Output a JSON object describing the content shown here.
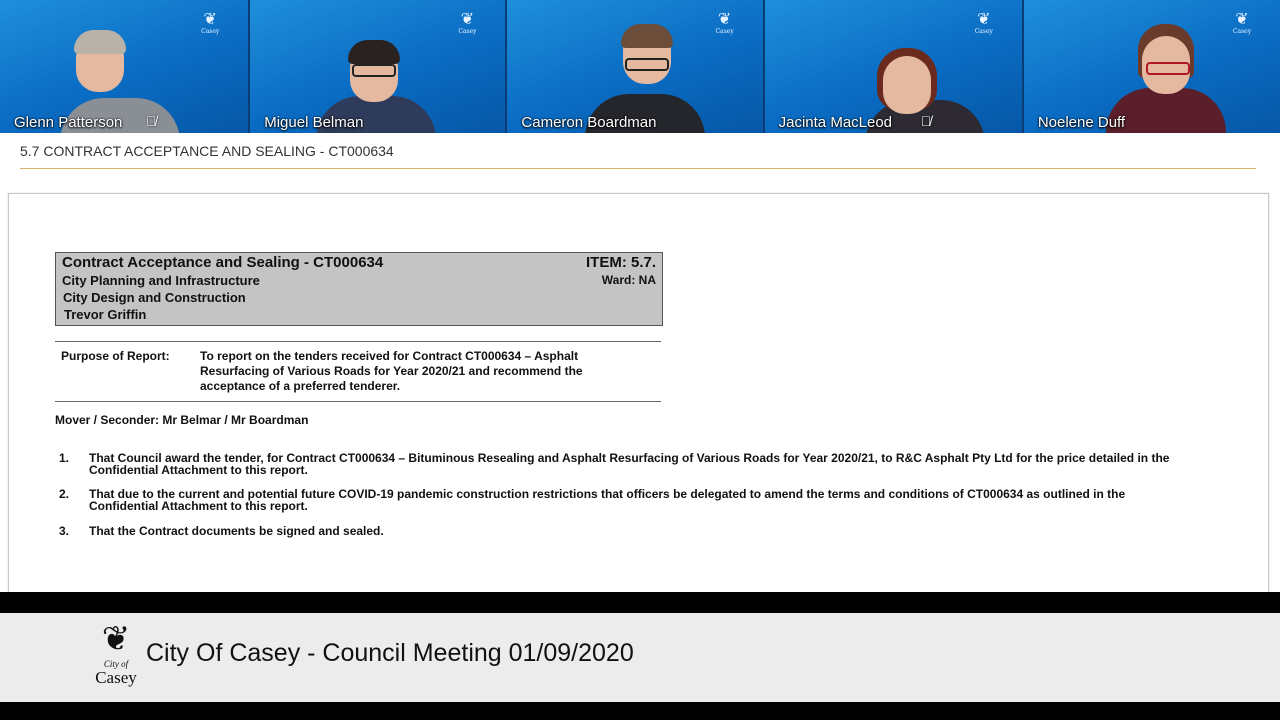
{
  "participants": [
    {
      "name": "Glenn Patterson",
      "muted": true,
      "mic_icon": "mic-off-icon"
    },
    {
      "name": "Miguel Belman",
      "muted": false,
      "mic_icon": ""
    },
    {
      "name": "Cameron Boardman",
      "muted": false,
      "mic_icon": ""
    },
    {
      "name": "Jacinta MacLeod",
      "muted": true,
      "mic_icon": "mic-off-icon"
    },
    {
      "name": "Noelene Duff",
      "muted": false,
      "mic_icon": ""
    }
  ],
  "tile_logo": {
    "mark": "❦",
    "text_top": "City of",
    "text_bottom": "Casey"
  },
  "agenda_item": "5.7 CONTRACT ACCEPTANCE AND SEALING - CT000634",
  "report": {
    "heading": "Contract Acceptance and Sealing - CT000634",
    "item": "ITEM: 5.7.",
    "ward": "Ward: NA",
    "department": "City Planning and Infrastructure",
    "branch": "City Design and Construction",
    "officer": "Trevor Griffin",
    "purpose_label": "Purpose of Report:",
    "purpose_text": "To report on the tenders received for Contract CT000634 – Asphalt Resurfacing of Various Roads for Year 2020/21 and recommend the acceptance of a preferred tenderer.",
    "mover": "Mover / Seconder: Mr Belmar / Mr Boardman",
    "resolutions": [
      {
        "num": "1.",
        "text": "That Council award the tender, for Contract CT000634 – Bituminous Resealing and Asphalt Resurfacing of Various Roads for Year 2020/21, to R&C Asphalt Pty Ltd for the price detailed in the Confidential Attachment to this report."
      },
      {
        "num": "2.",
        "text": "That due to the current and potential future COVID-19 pandemic construction restrictions that officers be delegated to amend the terms and conditions of CT000634 as outlined in the Confidential Attachment to this report."
      },
      {
        "num": "3.",
        "text": "That the Contract documents be signed and sealed."
      }
    ]
  },
  "banner": {
    "logo_small": "City of",
    "logo_big": "Casey",
    "title": "City Of Casey - Council Meeting 01/09/2020"
  },
  "colors": {
    "tile_blue": "#0a6cc3",
    "banner_bg": "#ececec",
    "divider_gold": "#d9b26a",
    "report_box_grey": "#c4c4c4"
  }
}
